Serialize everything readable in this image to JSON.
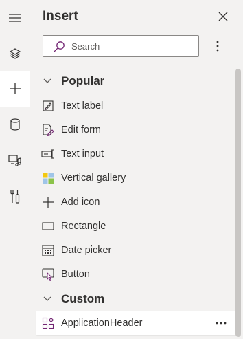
{
  "panel": {
    "title": "Insert",
    "search_placeholder": "Search"
  },
  "rail": {
    "icons": [
      "hamburger-icon",
      "layers-icon",
      "plus-icon",
      "data-icon",
      "media-icon",
      "tools-icon"
    ],
    "active": "plus-icon"
  },
  "groups": [
    {
      "label": "Popular",
      "items": [
        {
          "label": "Text label",
          "icon": "text-label-icon"
        },
        {
          "label": "Edit form",
          "icon": "edit-form-icon"
        },
        {
          "label": "Text input",
          "icon": "text-input-icon"
        },
        {
          "label": "Vertical gallery",
          "icon": "vertical-gallery-icon"
        },
        {
          "label": "Add icon",
          "icon": "add-icon"
        },
        {
          "label": "Rectangle",
          "icon": "rectangle-icon"
        },
        {
          "label": "Date picker",
          "icon": "date-picker-icon"
        },
        {
          "label": "Button",
          "icon": "button-icon"
        }
      ]
    },
    {
      "label": "Custom",
      "items": [
        {
          "label": "ApplicationHeader",
          "icon": "component-icon"
        }
      ]
    }
  ],
  "colors": {
    "background": "#f3f2f1",
    "text": "#323130",
    "gallery_yellow": "#f2c811",
    "gallery_blue": "#9fc5e8",
    "gallery_green": "#8bc34a",
    "accent": "#742774"
  }
}
